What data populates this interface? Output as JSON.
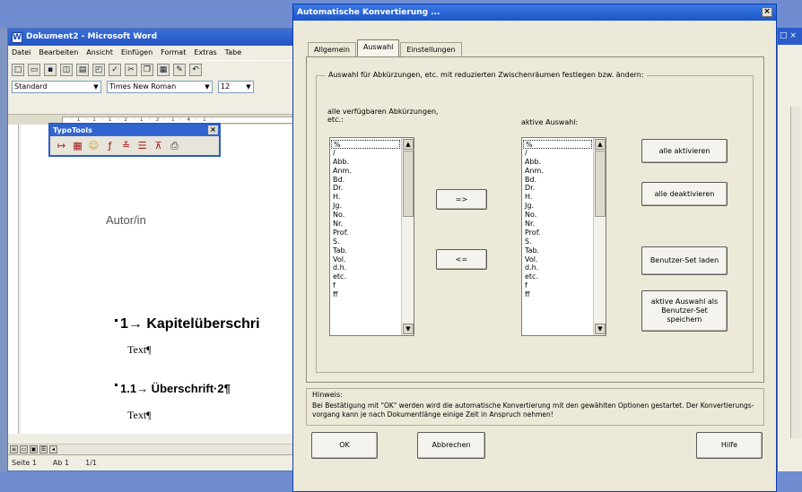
{
  "word": {
    "title": "Dokument2 - Microsoft Word",
    "menu": [
      "Datei",
      "Bearbeiten",
      "Ansicht",
      "Einfügen",
      "Format",
      "Extras",
      "Tabe"
    ],
    "style_value": "Standard",
    "font_value": "Times New Roman",
    "size_value": "12",
    "document": {
      "author": "Autor/in",
      "heading1": "1→ Kapitelüberschri",
      "text1": "Text¶",
      "heading2": "1.1→ Überschrift·2¶",
      "text2": "Text¶"
    },
    "status": {
      "page": "Seite 1",
      "section": "Ab 1",
      "pages": "1/1"
    }
  },
  "typotools": {
    "title": "TypoTools",
    "close": "×"
  },
  "dialog": {
    "title": "Automatische Konvertierung ...",
    "close": "×",
    "tabs": [
      "Allgemein",
      "Auswahl",
      "Einstellungen"
    ],
    "active_tab": "Auswahl",
    "group_label": "Auswahl für Abkürzungen, etc. mit reduzierten Zwischenräumen festlegen bzw. ändern:",
    "left_label": "alle verfügbaren Abkürzungen, etc.:",
    "right_label": "aktive Auswahl:",
    "list_items": [
      "%",
      "/",
      "Abb.",
      "Anm.",
      "Bd.",
      "Dr.",
      "H.",
      "Jg.",
      "No.",
      "Nr.",
      "Prof.",
      "S.",
      "Tab.",
      "Vol.",
      "d.h.",
      "etc.",
      "f",
      "ff"
    ],
    "buttons": {
      "add": "=>",
      "remove": "<=",
      "activate_all": "alle aktivieren",
      "deactivate_all": "alle deaktivieren",
      "load_set": "Benutzer-Set laden",
      "save_set": "aktive Auswahl als Benutzer-Set speichern",
      "ok": "OK",
      "cancel": "Abbrechen",
      "help": "Hilfe"
    },
    "hint_label": "Hinweis:",
    "hint_text": "Bei Bestätigung mit \"OK\" werden wird die automatische Konvertierung mit den gewählten Optionen gestartet. Der Konvertierungs-vorgang kann je nach Dokumentlänge einige Zeit in Anspruch nehmen!"
  }
}
